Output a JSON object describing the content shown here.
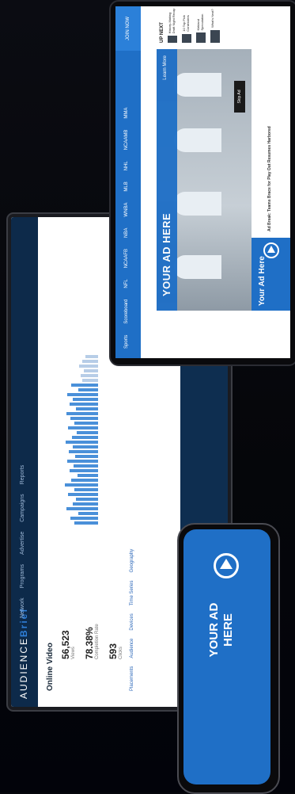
{
  "laptop": {
    "brand_main": "AUDIENCE",
    "brand_accent": "Brief",
    "nav": [
      "Network",
      "Programs",
      "Advertise",
      "Campaigns",
      "Reports"
    ],
    "page_title": "Online Video",
    "kpis": [
      {
        "value": "56,523",
        "label": "Views"
      },
      {
        "value": "78.38%",
        "label": "Completion Rate"
      },
      {
        "value": "593",
        "label": "Clicks"
      }
    ],
    "tabs": [
      "Placements",
      "Audience",
      "Devices",
      "Time Series",
      "Geography"
    ],
    "accent_color": "#1f5aa8"
  },
  "tablet": {
    "nav": [
      "Sports",
      "Scoreboard",
      "NFL",
      "NCAAFB",
      "NBA",
      "WNBA",
      "MLB",
      "NHL",
      "NCAAMB",
      "MMA"
    ],
    "join": "JOIN NOW",
    "ad_banner": "YOUR AD HERE",
    "learn_more": "Learn More",
    "skip": "Skip Ad",
    "ad_box": "Your Ad Here",
    "caption": "Ad Break: Teams Brace for Play Out Resumes Harbored",
    "up_next_label": "UP NEXT",
    "up_next": [
      "History-Making Draft Night Recap",
      "10 Top Pick Contenders",
      "Kirkland Speculation",
      "What's Next?"
    ],
    "accent_color": "#1f6fc6"
  },
  "phone": {
    "ad_text": "YOUR AD HERE",
    "accent_color": "#1f6fc6"
  }
}
